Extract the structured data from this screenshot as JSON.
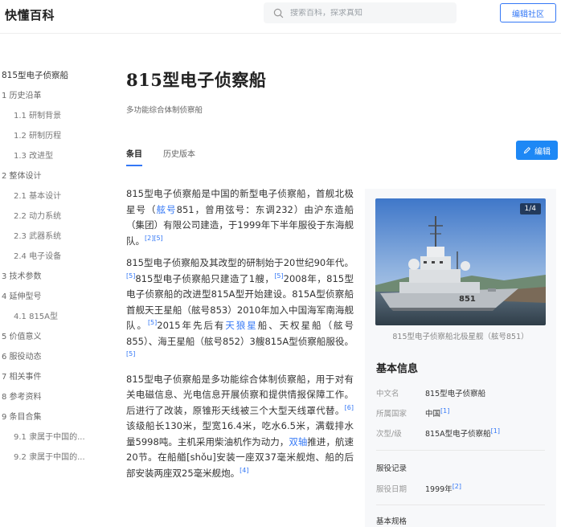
{
  "header": {
    "logo": "快懂百科",
    "search_placeholder": "搜索百科，探求真知",
    "edit_community": "编辑社区"
  },
  "toc": {
    "title": "815型电子侦察船",
    "items": [
      {
        "label": "1 历史沿革",
        "level": 1
      },
      {
        "label": "1.1 研制背景",
        "level": 2
      },
      {
        "label": "1.2 研制历程",
        "level": 2
      },
      {
        "label": "1.3 改进型",
        "level": 2
      },
      {
        "label": "2 整体设计",
        "level": 1
      },
      {
        "label": "2.1 基本设计",
        "level": 2
      },
      {
        "label": "2.2 动力系统",
        "level": 2
      },
      {
        "label": "2.3 武器系统",
        "level": 2
      },
      {
        "label": "2.4 电子设备",
        "level": 2
      },
      {
        "label": "3 技术参数",
        "level": 1
      },
      {
        "label": "4 延伸型号",
        "level": 1
      },
      {
        "label": "4.1 815A型",
        "level": 2
      },
      {
        "label": "5 价值意义",
        "level": 1
      },
      {
        "label": "6 服役动态",
        "level": 1
      },
      {
        "label": "7 相关事件",
        "level": 1
      },
      {
        "label": "8 参考资料",
        "level": 1
      },
      {
        "label": "9 条目合集",
        "level": 1
      },
      {
        "label": "9.1 隶属于中国的...",
        "level": 2
      },
      {
        "label": "9.2 隶属于中国的...",
        "level": 2
      }
    ]
  },
  "article": {
    "title": "815型电子侦察船",
    "subtitle": "多功能综合体制侦察船",
    "tabs": [
      "条目",
      "历史版本"
    ],
    "edit_label": "编辑",
    "paragraphs": [
      [
        {
          "t": "815型电子侦察船是中国的新型电子侦察船，首舰北极星号（"
        },
        {
          "t": "舷号",
          "link": true
        },
        {
          "t": "851，曾用弦号：东调232）由沪东造船（集团）有限公司建造，于1999年下半年服役于东海舰队。"
        },
        {
          "t": "[2][5]",
          "sup": true
        }
      ],
      [
        {
          "t": "815型电子侦察船及其改型的研制始于20世纪90年代。"
        },
        {
          "t": "[5]",
          "sup": true
        },
        {
          "t": "815型电子侦察船只建造了1艘，"
        },
        {
          "t": "[5]",
          "sup": true
        },
        {
          "t": "2008年，815型电子侦察船的改进型815A型开始建设。815A型侦察船首舰天王星船（舷号853）2010年加入中国海军南海舰队。"
        },
        {
          "t": "[5]",
          "sup": true
        },
        {
          "t": "2015年先后有"
        },
        {
          "t": "天狼星",
          "link": true
        },
        {
          "t": "船、天权星船（舷号855）、海王星船（舷号852）3艘815A型侦察船服役。"
        },
        {
          "t": "[5]",
          "sup": true
        }
      ],
      [
        {
          "t": "815型电子侦察船是多功能综合体制侦察船，用于对有关电磁信息、光电信息开展侦察和提供情报保障工作。后进行了改装，原锥形天线被三个大型天线罩代替。"
        },
        {
          "t": "[6]",
          "sup": true
        },
        {
          "t": "该级船长130米，型宽16.4米，吃水6.5米，满载排水量5998吨。主机采用柴油机作为动力，"
        },
        {
          "t": "双轴",
          "link": true
        },
        {
          "t": "推进，航速20节。在船艏[shǒu]安装一座双37毫米舰炮、船的后部安装两座双25毫米舰炮。"
        },
        {
          "t": "[4]",
          "sup": true
        }
      ]
    ]
  },
  "infobox": {
    "photo_counter": "1/4",
    "hull_number": "851",
    "caption": "815型电子侦察船北极星舰（舷号851）",
    "basic_info_title": "基本信息",
    "rows": [
      {
        "key": "中文名",
        "value": "815型电子侦察船",
        "sup": ""
      },
      {
        "key": "所属国家",
        "value": "中国",
        "sup": "[1]"
      },
      {
        "key": "次型/级",
        "value": "815A型电子侦察船",
        "sup": "[1]"
      }
    ],
    "service_title": "服役记录",
    "service_rows": [
      {
        "key": "服役日期",
        "value": "1999年",
        "sup": "[2]"
      }
    ],
    "specs_title": "基本规格"
  },
  "colors": {
    "accent": "#3478f6",
    "edit_button": "#1e88f5",
    "infobox_bg": "#f7f8fa"
  }
}
